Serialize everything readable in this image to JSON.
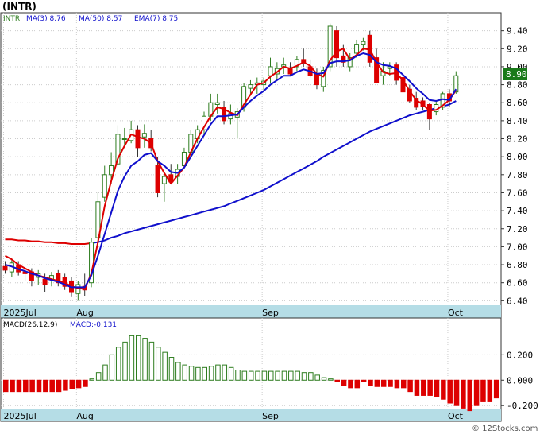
{
  "title": "(INTR)",
  "watermark": "© 12Stocks.com",
  "colors": {
    "up": "#2e7d1f",
    "down": "#dd0000",
    "ma3": "#dd0000",
    "ma50": "#1010cc",
    "ema7": "#1010cc",
    "axisBand": "#b5dde6",
    "grid": "#cccccc",
    "priceTag": "#1a7a1a"
  },
  "legend": {
    "symbol": "INTR",
    "ma3": "MA(3)  8.76",
    "ma50": "MA(50)  8.57",
    "ema7": "EMA(7)  8.75"
  },
  "price_tag": "8.90",
  "macd_legend": {
    "params": "MACD(26,12,9)",
    "value": "MACD:-0.131"
  },
  "chart_data": [
    {
      "type": "candlestick",
      "ylim": [
        6.35,
        9.6
      ],
      "yticks": [
        "9.40",
        "9.20",
        "9.00",
        "8.80",
        "8.60",
        "8.40",
        "8.20",
        "8.00",
        "7.80",
        "7.60",
        "7.40",
        "7.20",
        "7.00",
        "6.80",
        "6.60",
        "6.40"
      ],
      "xlabels": [
        {
          "label": "2025Jul",
          "index": 0
        },
        {
          "label": "Aug",
          "index": 11
        },
        {
          "label": "Sep",
          "index": 39
        },
        {
          "label": "Oct",
          "index": 67
        }
      ],
      "candles": [
        [
          6.78,
          6.84,
          6.7,
          6.74
        ],
        [
          6.72,
          6.86,
          6.66,
          6.82
        ],
        [
          6.8,
          6.84,
          6.68,
          6.72
        ],
        [
          6.72,
          6.76,
          6.62,
          6.7
        ],
        [
          6.72,
          6.76,
          6.56,
          6.62
        ],
        [
          6.66,
          6.74,
          6.58,
          6.7
        ],
        [
          6.64,
          6.7,
          6.5,
          6.58
        ],
        [
          6.64,
          6.72,
          6.56,
          6.68
        ],
        [
          6.7,
          6.74,
          6.56,
          6.6
        ],
        [
          6.66,
          6.7,
          6.52,
          6.56
        ],
        [
          6.62,
          6.66,
          6.44,
          6.5
        ],
        [
          6.48,
          6.62,
          6.4,
          6.58
        ],
        [
          6.56,
          6.7,
          6.45,
          6.52
        ],
        [
          6.6,
          7.1,
          6.55,
          7.05
        ],
        [
          7.1,
          7.6,
          7.05,
          7.5
        ],
        [
          7.55,
          7.9,
          7.5,
          7.8
        ],
        [
          7.8,
          8.05,
          7.7,
          7.9
        ],
        [
          7.92,
          8.35,
          7.88,
          8.25
        ],
        [
          8.2,
          8.32,
          8.12,
          8.2
        ],
        [
          8.18,
          8.4,
          8.15,
          8.3
        ],
        [
          8.3,
          8.35,
          8.0,
          8.1
        ],
        [
          8.22,
          8.36,
          8.1,
          8.26
        ],
        [
          8.2,
          8.3,
          8.06,
          8.1
        ],
        [
          7.9,
          8.0,
          7.55,
          7.6
        ],
        [
          7.7,
          7.82,
          7.5,
          7.78
        ],
        [
          7.8,
          7.92,
          7.7,
          7.72
        ],
        [
          7.78,
          7.92,
          7.7,
          7.86
        ],
        [
          7.9,
          8.1,
          7.86,
          8.05
        ],
        [
          8.05,
          8.3,
          8.0,
          8.25
        ],
        [
          8.2,
          8.35,
          8.15,
          8.3
        ],
        [
          8.3,
          8.5,
          8.25,
          8.45
        ],
        [
          8.45,
          8.7,
          8.4,
          8.6
        ],
        [
          8.58,
          8.7,
          8.48,
          8.6
        ],
        [
          8.55,
          8.62,
          8.36,
          8.4
        ],
        [
          8.42,
          8.58,
          8.36,
          8.48
        ],
        [
          8.44,
          8.54,
          8.2,
          8.5
        ],
        [
          8.55,
          8.82,
          8.5,
          8.78
        ],
        [
          8.76,
          8.85,
          8.68,
          8.8
        ],
        [
          8.8,
          8.88,
          8.7,
          8.82
        ],
        [
          8.8,
          8.88,
          8.74,
          8.84
        ],
        [
          8.9,
          9.1,
          8.82,
          9.0
        ],
        [
          8.92,
          9.05,
          8.85,
          8.98
        ],
        [
          9.0,
          9.1,
          8.92,
          9.02
        ],
        [
          8.98,
          9.05,
          8.9,
          8.92
        ],
        [
          9.0,
          9.12,
          8.95,
          9.08
        ],
        [
          9.08,
          9.2,
          9.0,
          9.05
        ],
        [
          9.0,
          9.08,
          8.88,
          8.9
        ],
        [
          8.92,
          8.98,
          8.75,
          8.8
        ],
        [
          8.78,
          9.0,
          8.72,
          8.96
        ],
        [
          9.0,
          9.48,
          8.95,
          9.45
        ],
        [
          9.4,
          9.45,
          9.0,
          9.1
        ],
        [
          9.12,
          9.25,
          9.0,
          9.05
        ],
        [
          9.0,
          9.15,
          8.95,
          9.1
        ],
        [
          9.15,
          9.3,
          9.1,
          9.25
        ],
        [
          9.25,
          9.32,
          9.18,
          9.28
        ],
        [
          9.35,
          9.4,
          9.0,
          9.05
        ],
        [
          9.1,
          9.2,
          8.85,
          8.82
        ],
        [
          8.9,
          9.05,
          8.8,
          8.95
        ],
        [
          8.98,
          9.05,
          8.9,
          9.0
        ],
        [
          9.02,
          9.05,
          8.8,
          8.85
        ],
        [
          8.88,
          8.9,
          8.7,
          8.72
        ],
        [
          8.75,
          8.8,
          8.6,
          8.62
        ],
        [
          8.65,
          8.72,
          8.52,
          8.55
        ],
        [
          8.62,
          8.66,
          8.52,
          8.56
        ],
        [
          8.58,
          8.6,
          8.3,
          8.42
        ],
        [
          8.5,
          8.62,
          8.46,
          8.58
        ],
        [
          8.55,
          8.72,
          8.52,
          8.7
        ],
        [
          8.7,
          8.75,
          8.55,
          8.62
        ],
        [
          8.72,
          8.95,
          8.7,
          8.9
        ]
      ],
      "ma3": [
        6.9,
        6.86,
        6.8,
        6.76,
        6.72,
        6.68,
        6.66,
        6.64,
        6.62,
        6.6,
        6.56,
        6.54,
        6.53,
        6.7,
        7.05,
        7.45,
        7.73,
        7.98,
        8.12,
        8.25,
        8.22,
        8.2,
        8.15,
        7.95,
        7.82,
        7.7,
        7.79,
        7.88,
        8.05,
        8.2,
        8.33,
        8.45,
        8.55,
        8.53,
        8.49,
        8.46,
        8.58,
        8.69,
        8.8,
        8.82,
        8.89,
        8.94,
        9.0,
        8.98,
        9.01,
        9.05,
        9.01,
        8.92,
        8.89,
        9.07,
        9.17,
        9.2,
        9.08,
        9.13,
        9.2,
        9.19,
        9.05,
        8.94,
        8.92,
        8.93,
        8.85,
        8.73,
        8.63,
        8.58,
        8.51,
        8.52,
        8.57,
        8.63,
        8.74
      ],
      "ema7": [
        6.8,
        6.78,
        6.75,
        6.73,
        6.7,
        6.68,
        6.65,
        6.63,
        6.61,
        6.58,
        6.55,
        6.55,
        6.55,
        6.68,
        6.9,
        7.14,
        7.38,
        7.62,
        7.78,
        7.9,
        7.95,
        8.02,
        8.04,
        7.95,
        7.9,
        7.83,
        7.82,
        7.88,
        8.0,
        8.12,
        8.24,
        8.36,
        8.45,
        8.45,
        8.46,
        8.47,
        8.55,
        8.62,
        8.68,
        8.73,
        8.8,
        8.85,
        8.9,
        8.9,
        8.94,
        8.97,
        8.95,
        8.92,
        8.93,
        9.04,
        9.06,
        9.06,
        9.07,
        9.12,
        9.15,
        9.13,
        9.05,
        9.02,
        9.01,
        8.98,
        8.91,
        8.84,
        8.76,
        8.7,
        8.63,
        8.62,
        8.64,
        8.63,
        8.75
      ],
      "ma50": [
        7.08,
        7.08,
        7.07,
        7.07,
        7.06,
        7.06,
        7.05,
        7.05,
        7.04,
        7.04,
        7.03,
        7.03,
        7.03,
        7.04,
        7.05,
        7.07,
        7.1,
        7.12,
        7.15,
        7.17,
        7.19,
        7.21,
        7.23,
        7.25,
        7.27,
        7.29,
        7.31,
        7.33,
        7.35,
        7.37,
        7.39,
        7.41,
        7.43,
        7.45,
        7.48,
        7.51,
        7.54,
        7.57,
        7.6,
        7.63,
        7.67,
        7.71,
        7.75,
        7.79,
        7.83,
        7.87,
        7.91,
        7.95,
        8.0,
        8.04,
        8.08,
        8.12,
        8.16,
        8.2,
        8.24,
        8.28,
        8.31,
        8.34,
        8.37,
        8.4,
        8.43,
        8.46,
        8.48,
        8.5,
        8.52,
        8.54,
        8.56,
        8.58,
        8.62
      ]
    },
    {
      "type": "bar",
      "title": "MACD(26,12,9)",
      "ylim": [
        -0.23,
        0.39
      ],
      "yticks": [
        "0.200",
        "0.000",
        "-0.200"
      ],
      "values": [
        -0.09,
        -0.09,
        -0.09,
        -0.09,
        -0.09,
        -0.09,
        -0.09,
        -0.09,
        -0.09,
        -0.08,
        -0.07,
        -0.06,
        -0.05,
        0.01,
        0.06,
        0.12,
        0.2,
        0.26,
        0.3,
        0.35,
        0.35,
        0.33,
        0.3,
        0.26,
        0.22,
        0.18,
        0.14,
        0.12,
        0.11,
        0.1,
        0.1,
        0.11,
        0.12,
        0.12,
        0.1,
        0.08,
        0.07,
        0.07,
        0.07,
        0.07,
        0.07,
        0.07,
        0.07,
        0.07,
        0.07,
        0.06,
        0.06,
        0.04,
        0.02,
        0.01,
        -0.01,
        -0.04,
        -0.06,
        -0.06,
        -0.01,
        -0.04,
        -0.05,
        -0.05,
        -0.05,
        -0.06,
        -0.06,
        -0.09,
        -0.12,
        -0.12,
        -0.12,
        -0.13,
        -0.15,
        -0.18,
        -0.2,
        -0.22,
        -0.24,
        -0.2,
        -0.17,
        -0.17,
        -0.14
      ]
    }
  ]
}
